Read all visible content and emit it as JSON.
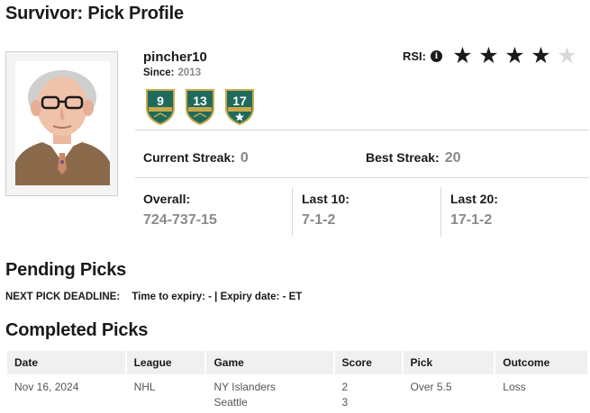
{
  "page": {
    "title": "Survivor: Pick Profile"
  },
  "profile": {
    "username": "pincher10",
    "since_label": "Since:",
    "since_value": "2013",
    "badges": [
      {
        "number": "9"
      },
      {
        "number": "13"
      },
      {
        "number": "17"
      }
    ],
    "rsi": {
      "label": "RSI:",
      "info_icon": "info-icon",
      "rating": 4,
      "max": 5
    },
    "current_streak_label": "Current Streak:",
    "current_streak_value": "0",
    "best_streak_label": "Best Streak:",
    "best_streak_value": "20",
    "overall_label": "Overall:",
    "overall_value": "724-737-15",
    "last10_label": "Last 10:",
    "last10_value": "7-1-2",
    "last20_label": "Last 20:",
    "last20_value": "17-1-2"
  },
  "pending": {
    "heading": "Pending Picks",
    "deadline_label": "NEXT PICK DEADLINE:",
    "expiry_text": "Time to expiry: - | Expiry date: - ET"
  },
  "completed": {
    "heading": "Completed Picks",
    "columns": [
      "Date",
      "League",
      "Game",
      "Score",
      "Pick",
      "Outcome"
    ],
    "rows": [
      {
        "date": "Nov 16, 2024",
        "league": "NHL",
        "team1": "NY Islanders",
        "team2": "Seattle",
        "score1": "2",
        "score2": "3",
        "pick": "Over 5.5",
        "outcome": "Loss"
      }
    ]
  },
  "colors": {
    "badge_green": "#1e6b5c",
    "badge_gold": "#c9a94a",
    "muted": "#8a8a8a"
  }
}
